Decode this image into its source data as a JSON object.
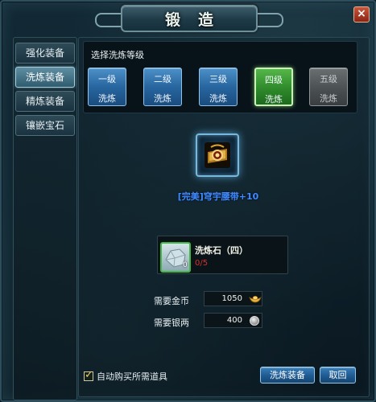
{
  "window": {
    "title": "锻造"
  },
  "tabs": [
    {
      "label": "强化装备",
      "active": false
    },
    {
      "label": "洗炼装备",
      "active": true
    },
    {
      "label": "精炼装备",
      "active": false
    },
    {
      "label": "镶嵌宝石",
      "active": false
    }
  ],
  "levels": {
    "label": "选择洗炼等级",
    "items": [
      {
        "line1": "一级",
        "line2": "洗炼",
        "state": "normal"
      },
      {
        "line1": "二级",
        "line2": "洗炼",
        "state": "normal"
      },
      {
        "line1": "三级",
        "line2": "洗炼",
        "state": "normal"
      },
      {
        "line1": "四级",
        "line2": "洗炼",
        "state": "selected"
      },
      {
        "line1": "五级",
        "line2": "洗炼",
        "state": "disabled"
      }
    ]
  },
  "item": {
    "name": "[完美]穹宇腰带+10",
    "icon": "belt-icon"
  },
  "material": {
    "name": "洗炼石（四）",
    "count": "0",
    "have": "0/5",
    "icon": "crystal-stone-icon"
  },
  "cost": {
    "gold_label": "需要金币",
    "gold_value": "1050",
    "gold_icon": "gold-ingot-icon",
    "silver_label": "需要银两",
    "silver_value": "400",
    "silver_icon": "silver-coin-icon"
  },
  "footer": {
    "auto_buy_label": "自动购买所需道具",
    "auto_buy_checked": true,
    "refine_button": "洗炼装备",
    "cancel_button": "取回"
  },
  "colors": {
    "item_name": "#3f8bff",
    "material_missing": "#d9302b",
    "selected_level": "#2f8a2b"
  }
}
